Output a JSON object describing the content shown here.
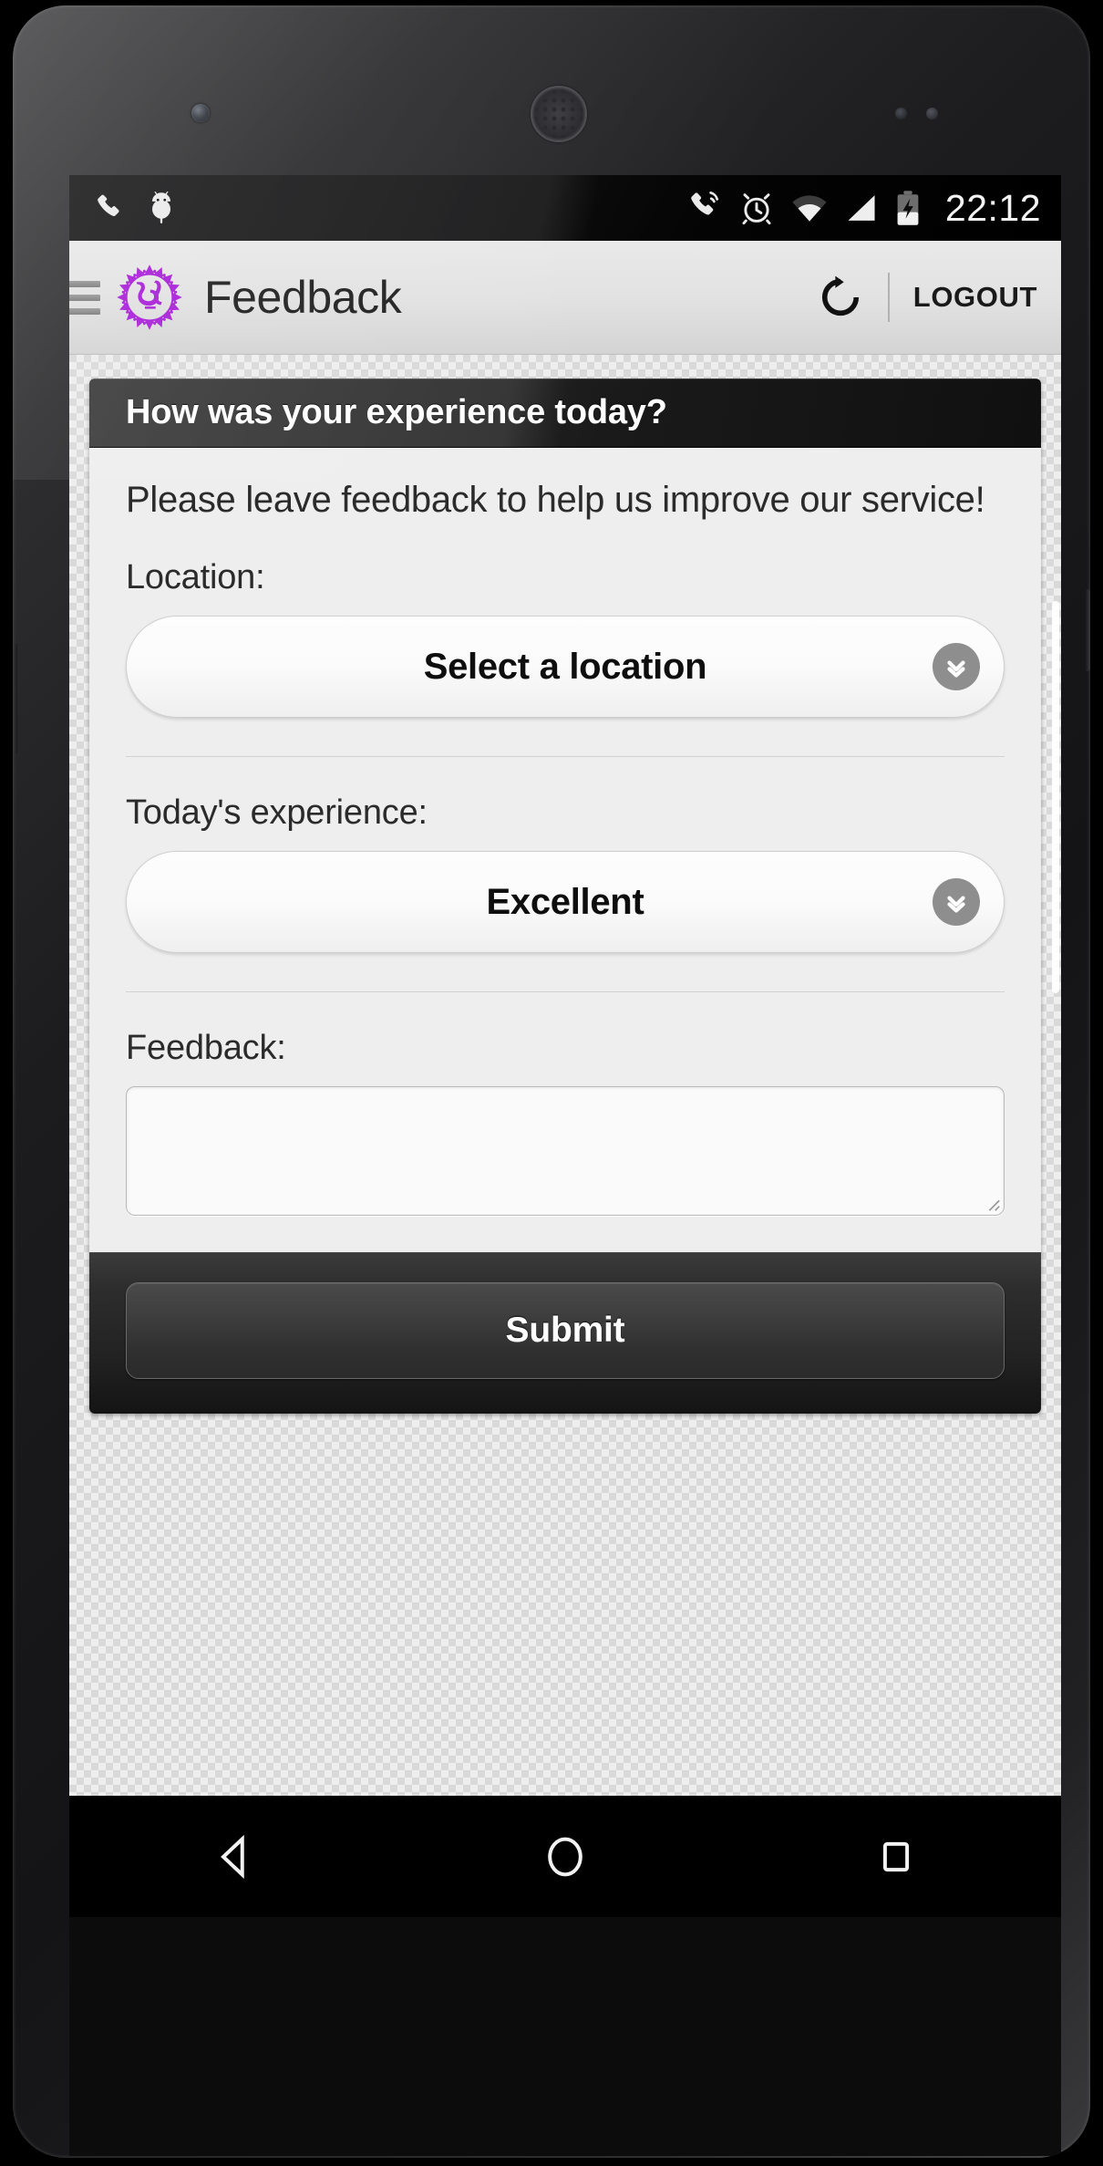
{
  "device": {
    "type": "android-phone",
    "icons": {
      "front_camera": "camera-icon",
      "earpiece": "speaker-grill-icon"
    }
  },
  "status_bar": {
    "left_icons": [
      "phone-handset-icon",
      "android-bug-icon"
    ],
    "right_icons": [
      "phone-ringing-icon",
      "alarm-clock-icon",
      "wifi-icon",
      "cellular-signal-icon",
      "battery-charging-icon"
    ],
    "clock": "22:12",
    "background_color": "#0a0a0a",
    "foreground_color": "#f4f4f4"
  },
  "app_bar": {
    "menu_icon": "hamburger-menu-icon",
    "logo_icon": "mandala-logo-icon",
    "logo_color": "#a922d8",
    "title": "Feedback",
    "refresh_icon": "refresh-icon",
    "logout_label": "LOGOUT",
    "background_color": "#e4e4e4",
    "text_color": "#212121"
  },
  "card": {
    "header_title": "How was your experience today?",
    "header_background": "#1b1b1b",
    "intro_text": "Please leave feedback to help us improve our service!",
    "fields": [
      {
        "key": "location",
        "label": "Location:",
        "type": "select",
        "value": "Select a location",
        "chevron_icon": "chevron-down-icon"
      },
      {
        "key": "experience",
        "label": "Today's experience:",
        "type": "select",
        "value": "Excellent",
        "chevron_icon": "chevron-down-icon"
      },
      {
        "key": "feedback",
        "label": "Feedback:",
        "type": "textarea",
        "value": "",
        "placeholder": ""
      }
    ],
    "footer": {
      "submit_label": "Submit",
      "background_color": "#232323"
    }
  },
  "nav_bar": {
    "buttons": [
      {
        "name": "back",
        "icon": "back-triangle-icon"
      },
      {
        "name": "home",
        "icon": "home-circle-icon"
      },
      {
        "name": "recents",
        "icon": "recents-square-icon"
      }
    ],
    "background_color": "#000000"
  }
}
